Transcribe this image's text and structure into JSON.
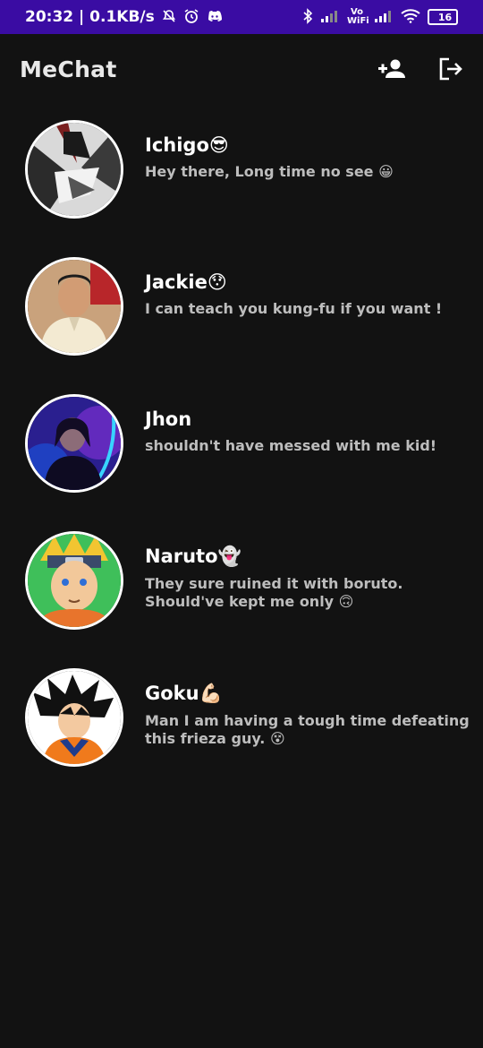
{
  "status_bar": {
    "time_speed": "20:32 | 0.1KB/s",
    "vo_wifi": "Vo WiFi",
    "battery": "16",
    "icons": [
      "mute-notification-icon",
      "alarm-icon",
      "discord-icon",
      "bluetooth-icon",
      "signal-icon",
      "wifi-icon",
      "battery-icon"
    ]
  },
  "app": {
    "title": "MeChat",
    "actions": [
      "add-friend-icon",
      "logout-icon"
    ]
  },
  "chats": [
    {
      "name": "Ichigo😎",
      "message": "Hey there, Long time no see 😀"
    },
    {
      "name": "Jackie😯",
      "message": "I can teach you kung-fu if you want !"
    },
    {
      "name": "Jhon",
      "message": "shouldn't have messed with me kid!"
    },
    {
      "name": "Naruto👻",
      "message": "They sure ruined it with boruto. Should've kept me only 🙃"
    },
    {
      "name": "Goku💪🏻",
      "message": "Man I am having a tough time defeating this frieza guy. 😵"
    }
  ],
  "colors": {
    "status_bar": "#3a0ca3",
    "background": "#121212",
    "name_text": "#ffffff",
    "message_text": "#bdbdbd"
  }
}
